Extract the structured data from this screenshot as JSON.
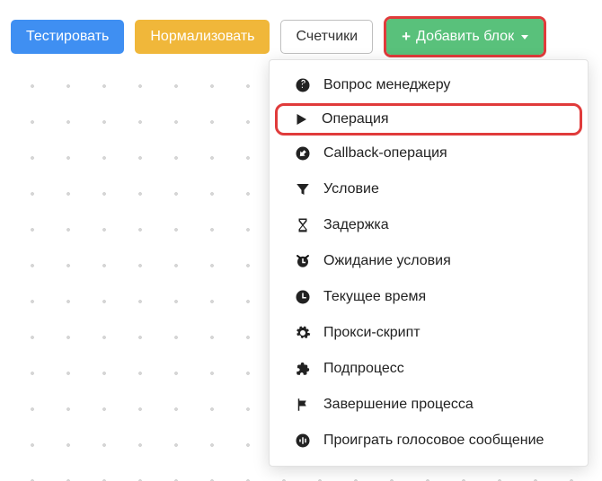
{
  "toolbar": {
    "test_label": "Тестировать",
    "normalize_label": "Нормализовать",
    "counters_label": "Счетчики",
    "add_label": "Добавить блок"
  },
  "dropdown": {
    "items": [
      {
        "icon": "question",
        "label": "Вопрос менеджеру",
        "highlighted": false
      },
      {
        "icon": "play",
        "label": "Операция",
        "highlighted": true
      },
      {
        "icon": "callback",
        "label": "Callback-операция",
        "highlighted": false
      },
      {
        "icon": "filter",
        "label": "Условие",
        "highlighted": false
      },
      {
        "icon": "hourglass",
        "label": "Задержка",
        "highlighted": false
      },
      {
        "icon": "alarm",
        "label": "Ожидание условия",
        "highlighted": false
      },
      {
        "icon": "clock",
        "label": "Текущее время",
        "highlighted": false
      },
      {
        "icon": "gear",
        "label": "Прокси-скрипт",
        "highlighted": false
      },
      {
        "icon": "puzzle",
        "label": "Подпроцесс",
        "highlighted": false
      },
      {
        "icon": "flag",
        "label": "Завершение процесса",
        "highlighted": false
      },
      {
        "icon": "voice",
        "label": "Проиграть голосовое сообщение",
        "highlighted": false
      }
    ]
  },
  "colors": {
    "highlight_border": "#e03b3b",
    "blue": "#3f8ff2",
    "yellow": "#f0b73a",
    "green": "#59c17b"
  }
}
